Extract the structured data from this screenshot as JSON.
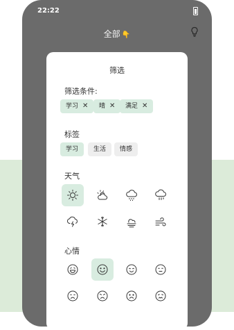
{
  "status_bar": {
    "time": "22:22"
  },
  "header": {
    "title": "全部",
    "dropdown_icon": "hand-down-icon",
    "action_icon": "lightbulb-icon"
  },
  "sheet": {
    "title": "筛选",
    "conditions": {
      "label": "筛选条件:",
      "chips": [
        "学习",
        "晴",
        "满足"
      ],
      "remove_glyph": "✕"
    },
    "tags": {
      "label": "标签",
      "items": [
        "学习",
        "生活",
        "情感"
      ],
      "selected_index": 0
    },
    "weather": {
      "label": "天气",
      "icons": [
        "sunny-icon",
        "partly-cloudy-icon",
        "rain-cloud-icon",
        "heavy-rain-cloud-icon",
        "thunderstorm-icon",
        "snowflake-icon",
        "haze-icon",
        "wind-icon"
      ],
      "selected_index": 0
    },
    "mood": {
      "label": "心情",
      "icons": [
        "laughing-face-icon",
        "smiling-face-icon",
        "content-face-icon",
        "neutral-face-icon",
        "sad-face-icon",
        "angry-face-icon",
        "frowning-face-icon",
        "annoyed-face-icon"
      ],
      "selected_index": 1
    }
  },
  "colors": {
    "selected_bg": "#d8ece0",
    "unselected_bg": "#eeeeee",
    "overlay": "#6b6b6b",
    "band": "#dcebd9"
  }
}
